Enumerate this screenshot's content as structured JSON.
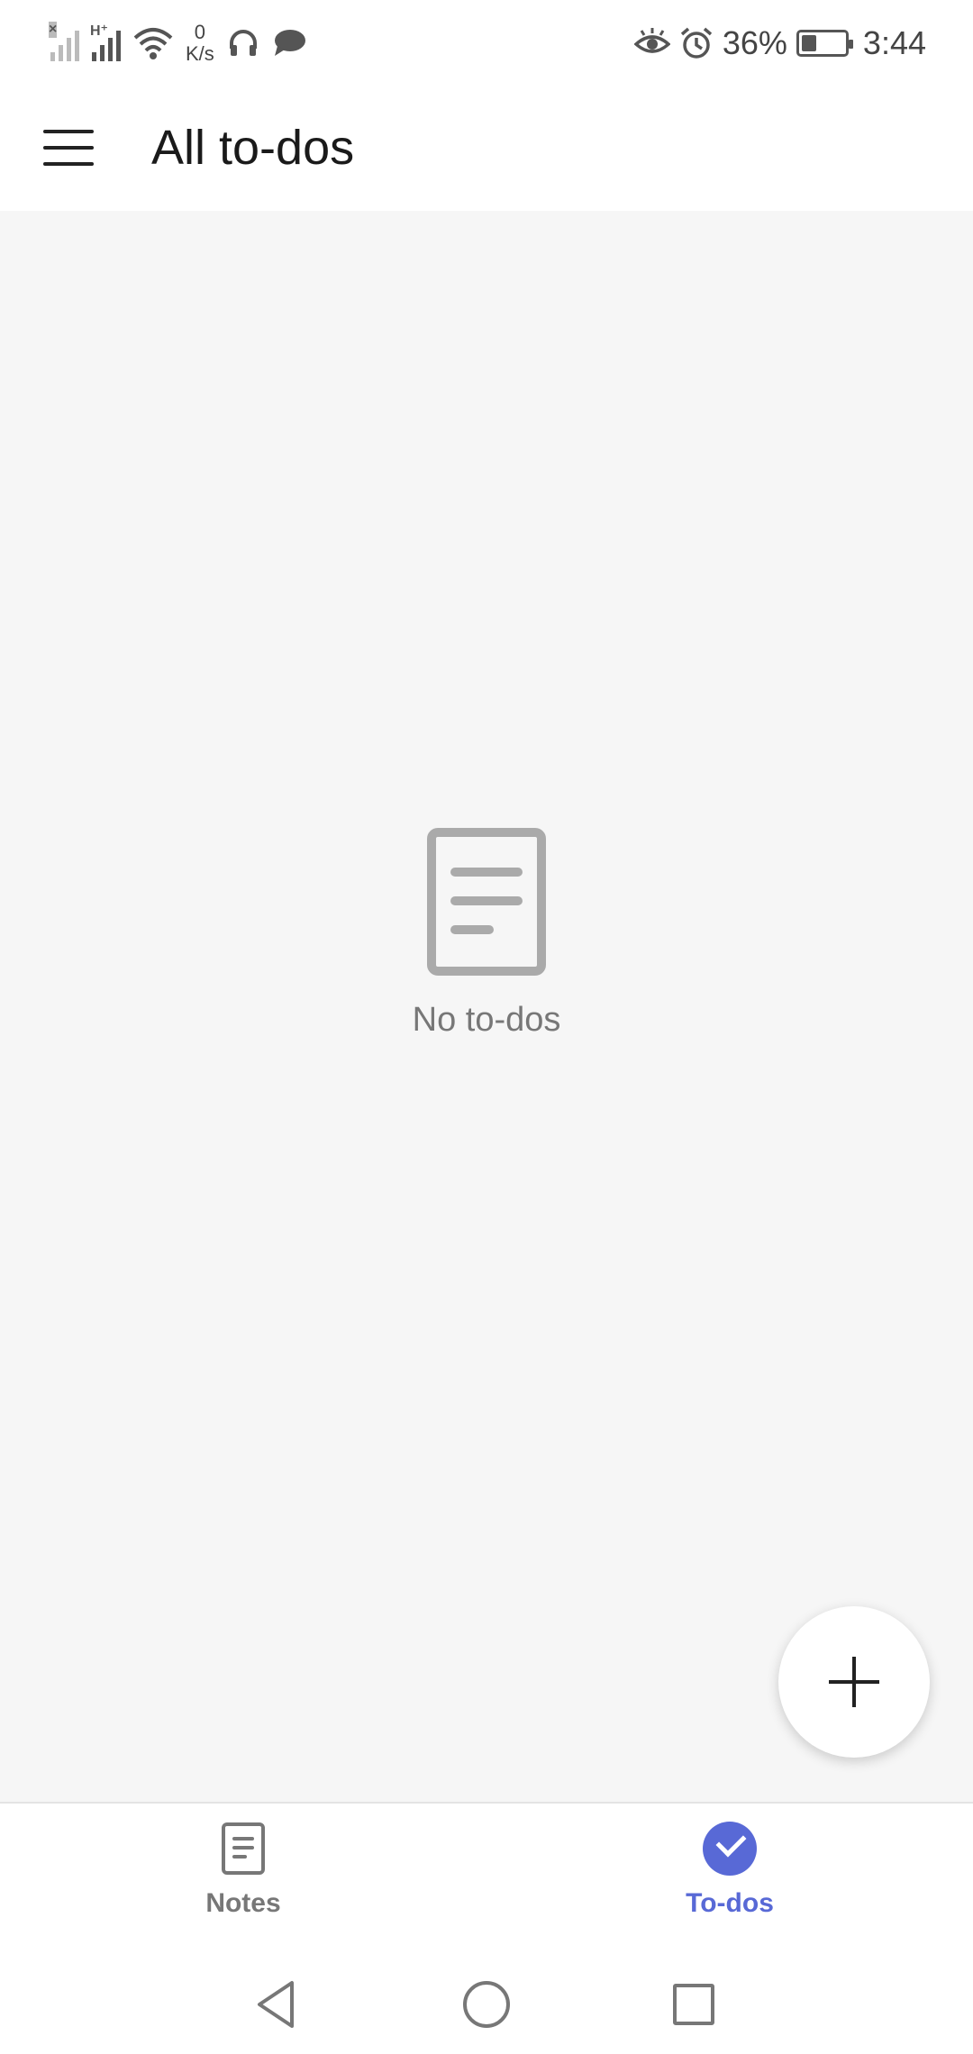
{
  "status_bar": {
    "net_speed_value": "0",
    "net_speed_unit": "K/s",
    "battery_percent": "36%",
    "battery_level": 0.36,
    "time": "3:44",
    "icons": [
      "no-signal-icon",
      "hplus-signal-icon",
      "wifi-icon",
      "headset-icon",
      "message-icon",
      "eye-comfort-icon",
      "alarm-icon",
      "battery-icon"
    ]
  },
  "app_bar": {
    "title": "All to-dos",
    "menu_icon": "hamburger-menu-icon"
  },
  "main": {
    "empty_state": {
      "icon": "document-icon",
      "text": "No to-dos"
    },
    "fab_icon": "plus-icon"
  },
  "bottom_nav": {
    "items": [
      {
        "label": "Notes",
        "icon": "notes-icon",
        "active": false
      },
      {
        "label": "To-dos",
        "icon": "check-circle-icon",
        "active": true
      }
    ],
    "active_color": "#5869d6",
    "inactive_color": "#777777"
  },
  "system_nav": {
    "icons": [
      "back-icon",
      "home-icon",
      "recents-icon"
    ]
  },
  "colors": {
    "accent": "#5869d6",
    "content_background": "#f6f6f6"
  }
}
